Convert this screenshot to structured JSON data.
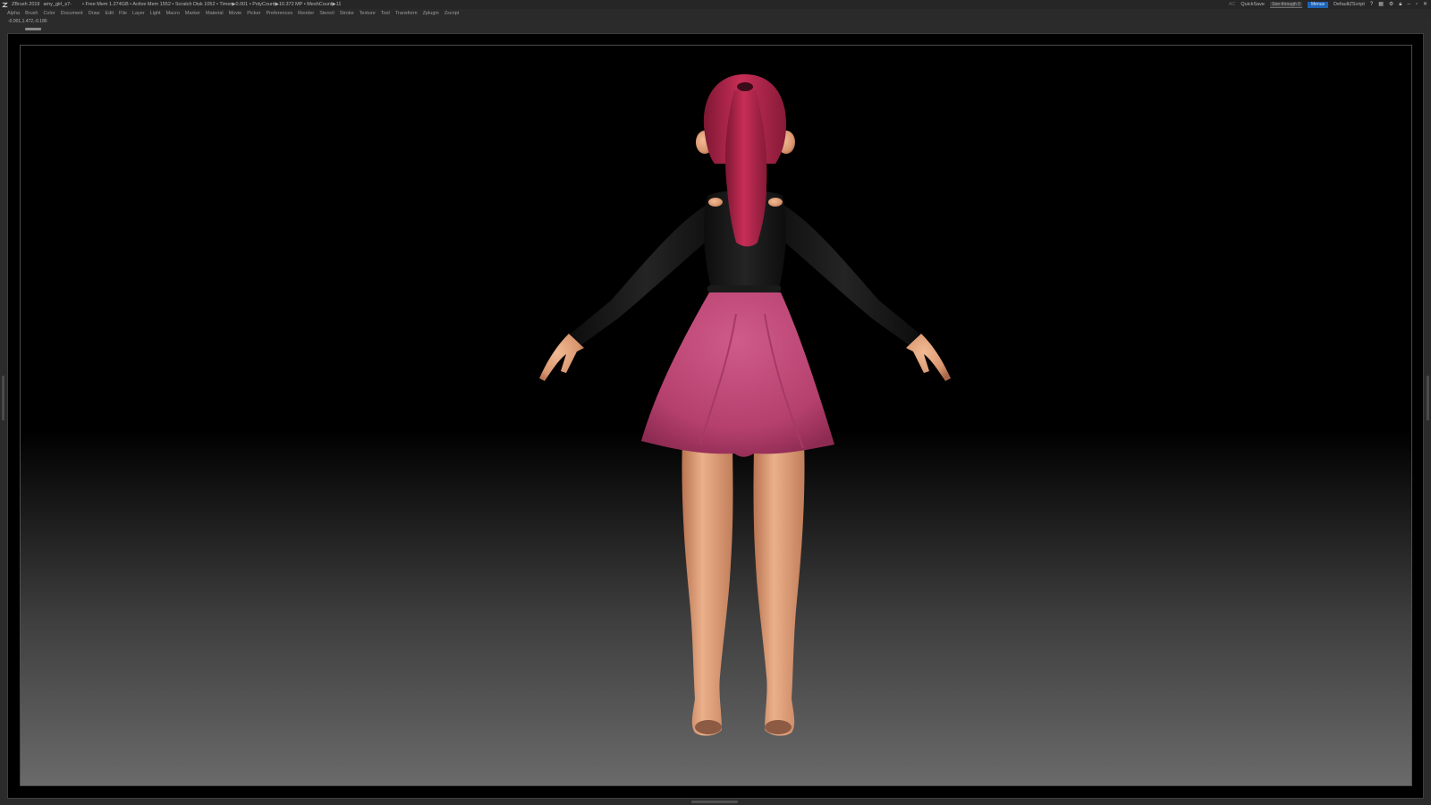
{
  "titlebar": {
    "app": "ZBrush 2019",
    "file": "amy_girl_s7-",
    "stats": "• Free Mem 1.274GB • Active Mem 1552 • Scratch Disk 1052 • Timer▶0.001 • PolyCount▶10.372 MP • MeshCount▶11",
    "ac": "AC",
    "quicksave": "QuickSave",
    "see_through": "See-through 0",
    "menus": "Menus",
    "script": "DefaultZScript"
  },
  "menubar": {
    "items": [
      "Alpha",
      "Brush",
      "Color",
      "Document",
      "Draw",
      "Edit",
      "File",
      "Layer",
      "Light",
      "Macro",
      "Marker",
      "Material",
      "Movie",
      "Picker",
      "Preferences",
      "Render",
      "Stencil",
      "Stroke",
      "Texture",
      "Tool",
      "Transform",
      "Zplugin",
      "Zscript"
    ]
  },
  "coords": "-0.001,1.472,-0.186",
  "colors": {
    "skirt": "#c44a7c",
    "hair": "#b3244a",
    "top": "#151515",
    "skin": "#e2a680",
    "menu_accent": "#1e63b3"
  },
  "icons": [
    "zbrush-logo-icon",
    "help-icon",
    "layout-icon",
    "settings-icon",
    "lock-icon",
    "minimize-icon",
    "maximize-icon",
    "close-icon"
  ]
}
